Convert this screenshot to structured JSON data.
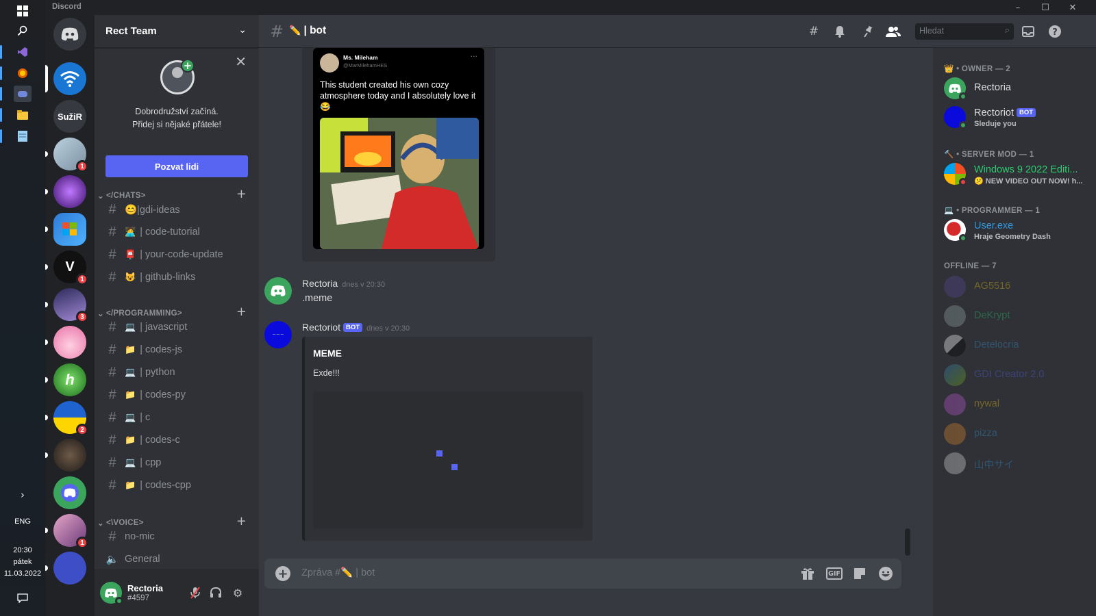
{
  "app": {
    "title": "Discord"
  },
  "window": {
    "minimize": "–",
    "maximize": "☐",
    "close": "✕"
  },
  "taskbar": {
    "lang": "ENG",
    "time": "20:30",
    "day": "pátek",
    "date": "11.03.2022"
  },
  "servers": [
    {
      "name": "home",
      "label": ""
    },
    {
      "name": "wifi-server",
      "label": ""
    },
    {
      "name": "suzir",
      "label": "SužiR"
    },
    {
      "name": "server-4",
      "label": "",
      "badge": "1"
    },
    {
      "name": "server-5",
      "label": ""
    },
    {
      "name": "windows7-server",
      "label": "Windows 7"
    },
    {
      "name": "v-server",
      "label": "V",
      "badge": "1"
    },
    {
      "name": "space-server",
      "label": "",
      "badge": "3"
    },
    {
      "name": "anime-server",
      "label": ""
    },
    {
      "name": "h-server",
      "label": "h"
    },
    {
      "name": "flag-server",
      "label": "",
      "badge": "2"
    },
    {
      "name": "dark-server",
      "label": ""
    },
    {
      "name": "discord-blue-server",
      "label": ""
    },
    {
      "name": "girls-server",
      "label": "",
      "badge": "1"
    },
    {
      "name": "red-server",
      "label": ""
    }
  ],
  "guild": {
    "name": "Rect Team"
  },
  "invite": {
    "line1": "Dobrodružství začíná.",
    "line2": "Přidej si nějaké přátele!",
    "button": "Pozvat lidi"
  },
  "categories": {
    "chats": "</CHATS>",
    "programming": "</PROGRAMMING>",
    "voice": "<\\VOICE>"
  },
  "channels": {
    "chats": [
      {
        "emoji": "",
        "name": "😊|gdi-ideas"
      },
      {
        "emoji": "🧑‍💻",
        "name": "| code-tutorial"
      },
      {
        "emoji": "📮",
        "name": "| your-code-update"
      },
      {
        "emoji": "😺",
        "name": "| github-links"
      }
    ],
    "programming": [
      {
        "emoji": "💻",
        "name": "| javascript"
      },
      {
        "emoji": "📁",
        "name": "| codes-js"
      },
      {
        "emoji": "💻",
        "name": "| python"
      },
      {
        "emoji": "📁",
        "name": "| codes-py"
      },
      {
        "emoji": "💻",
        "name": "| c"
      },
      {
        "emoji": "📁",
        "name": "| codes-c"
      },
      {
        "emoji": "💻",
        "name": "| cpp"
      },
      {
        "emoji": "📁",
        "name": "| codes-cpp"
      }
    ],
    "voice": [
      {
        "emoji": "",
        "name": "no-mic"
      },
      {
        "emoji": "",
        "name": "General"
      }
    ]
  },
  "user": {
    "name": "Rectoria",
    "tag": "#4597"
  },
  "channel": {
    "name": "| bot",
    "emoji": "✏️"
  },
  "search": {
    "placeholder": "Hledat"
  },
  "tweet": {
    "name": "Ms. Mileham",
    "handle": "@MarMilehamHES",
    "more": "···",
    "text": "This student created his own cozy atmosphere today and I absolutely love it 😂"
  },
  "messages": [
    {
      "author": "Rectoria",
      "time": "dnes v 20:30",
      "text": ".meme"
    },
    {
      "author": "Rectoriot",
      "bot": "BOT",
      "time": "dnes v 20:30",
      "embed_title": "MEME",
      "embed_desc": "Exde!!!"
    }
  ],
  "composer": {
    "placeholder": "Zpráva #✏️ | bot"
  },
  "members": {
    "groups": [
      {
        "title": "👑 • OWNER — 2"
      },
      {
        "title": "🔨 • SERVER MOD — 1"
      },
      {
        "title": "💻 • PROGRAMMER — 1"
      },
      {
        "title": "OFFLINE — 7"
      }
    ],
    "owner": [
      {
        "name": "Rectoria",
        "color": "#dcddde",
        "activity": ""
      },
      {
        "name": "Rectoriot",
        "bot": "BOT",
        "color": "#dcddde",
        "activity": "Sleduje you"
      }
    ],
    "mod": [
      {
        "name": "Windows 9 2022 Editi...",
        "color": "#2ecc71",
        "activity": "😕 NEW VIDEO OUT NOW! h..."
      }
    ],
    "programmer": [
      {
        "name": "User.exe",
        "color": "#3498db",
        "activity": "Hraje Geometry Dash"
      }
    ],
    "offline": [
      {
        "name": "AG5516",
        "color": "#f1c40f"
      },
      {
        "name": "DeKrypt",
        "color": "#2ecc71"
      },
      {
        "name": "Detelocria",
        "color": "#3498db"
      },
      {
        "name": "GDI Creator 2.0",
        "color": "#5865f2"
      },
      {
        "name": "nywal",
        "color": "#f1c40f"
      },
      {
        "name": "pizza",
        "color": "#3498db"
      },
      {
        "name": "山中サイ",
        "color": "#3498db"
      }
    ]
  },
  "colors": {
    "blurple": "#5865f2",
    "green": "#3ba55d",
    "red": "#ed4245",
    "bg": "#36393f"
  }
}
